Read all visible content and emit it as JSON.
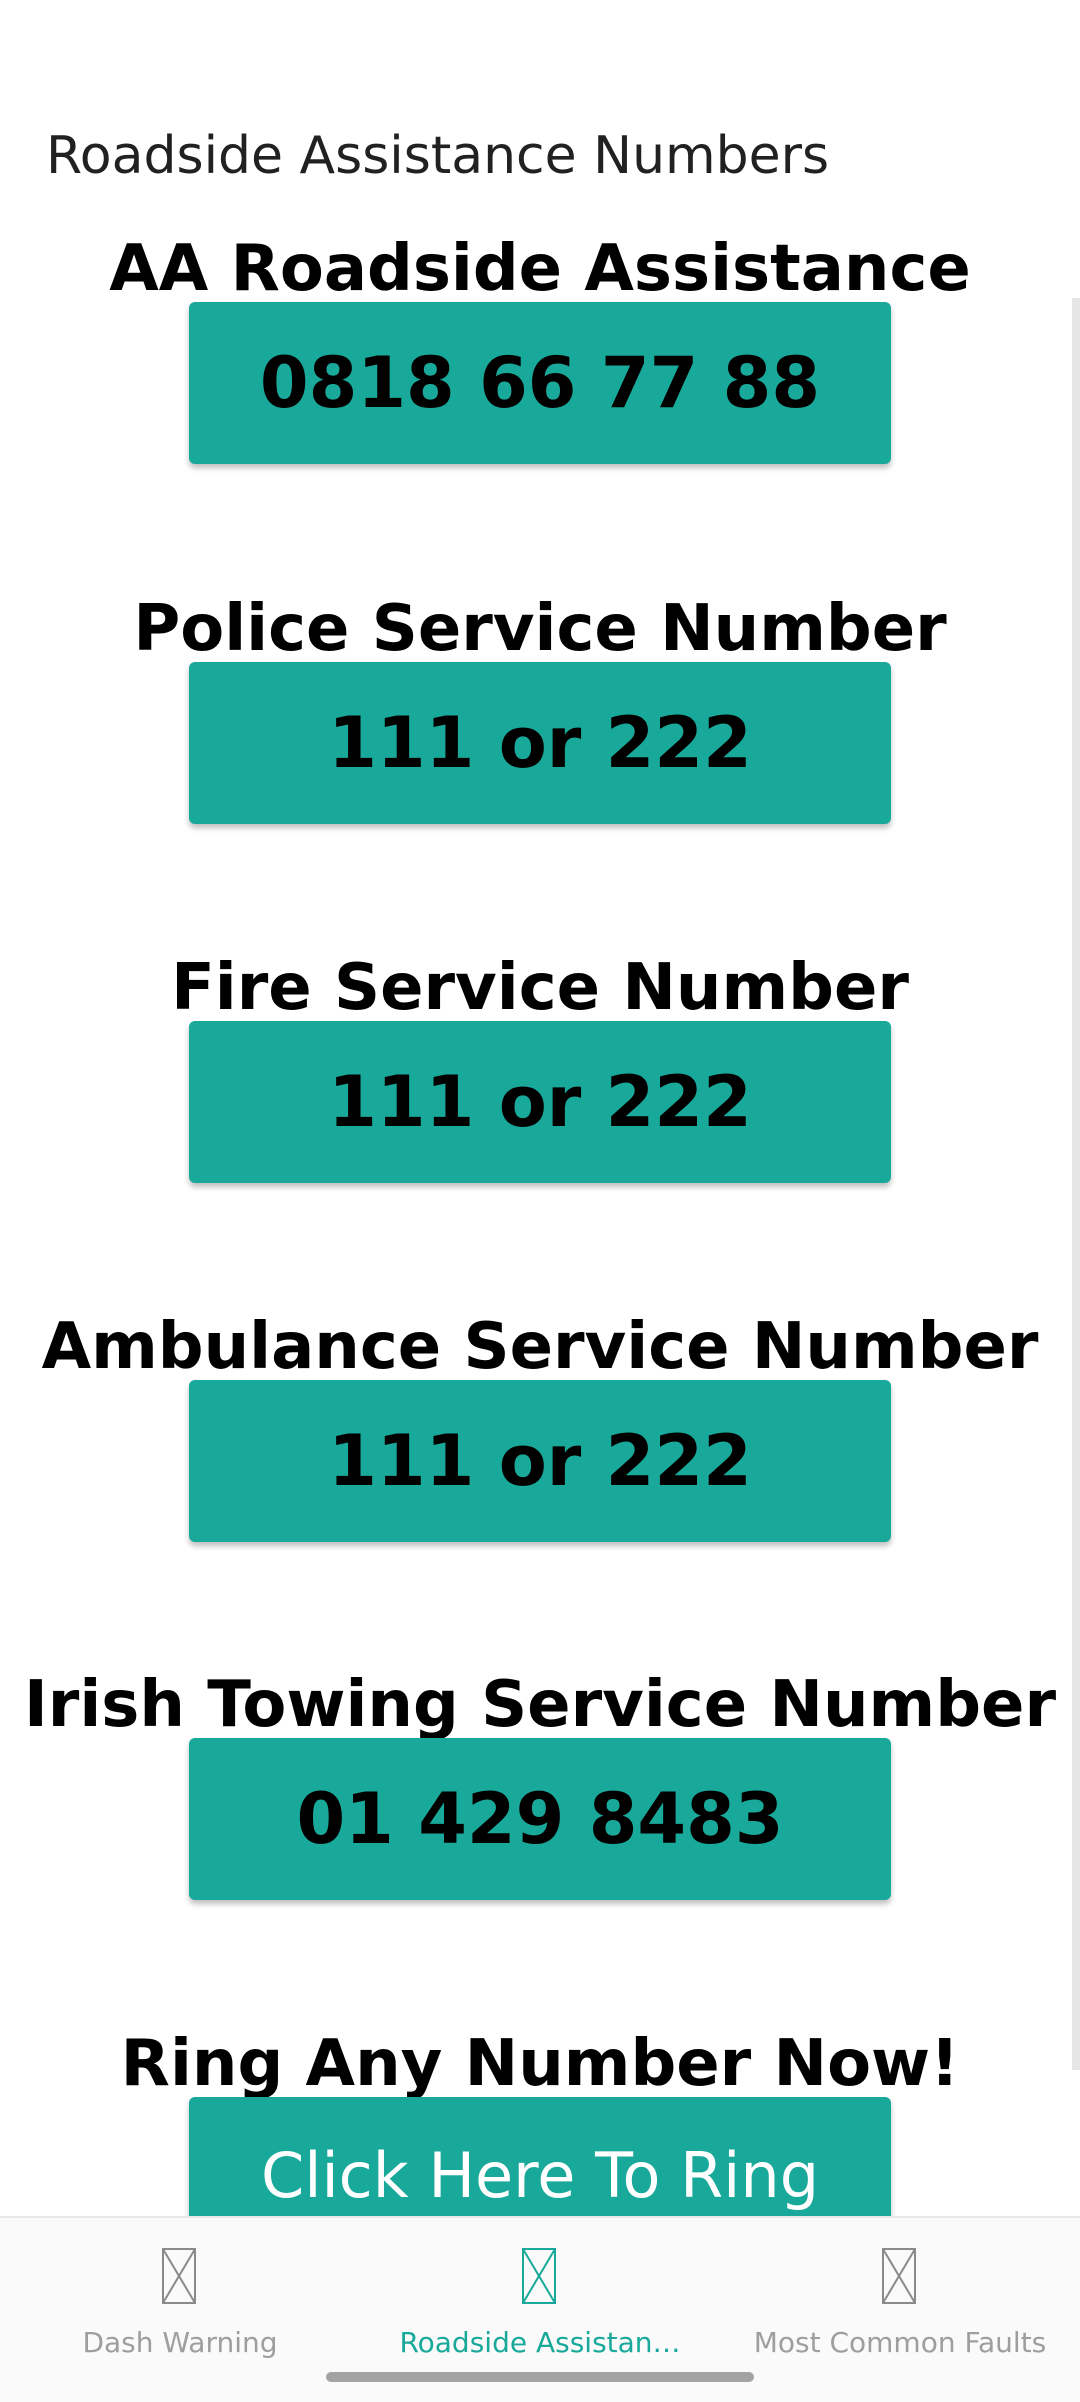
{
  "app_bar": {
    "title": "Roadside Assistance Numbers"
  },
  "sections": [
    {
      "title": "AA Roadside Assistance",
      "number": "0818 66 77 88"
    },
    {
      "title": "Police Service Number",
      "number": "111 or 222"
    },
    {
      "title": "Fire Service Number",
      "number": "111 or 222"
    },
    {
      "title": "Ambulance Service Number",
      "number": "111 or 222"
    },
    {
      "title": "Irish Towing Service Number",
      "number": "01 429 8483"
    },
    {
      "title": "Ring Any Number Now!",
      "number": "Click Here To Ring"
    }
  ],
  "bottom_nav": {
    "items": [
      {
        "label": "Dash Warning",
        "icon": "image-placeholder-icon",
        "active": false
      },
      {
        "label": "Roadside Assistan…",
        "icon": "image-placeholder-icon",
        "active": true
      },
      {
        "label": "Most Common Faults",
        "icon": "image-placeholder-icon",
        "active": false
      }
    ]
  },
  "colors": {
    "accent": "#19a99a",
    "inactive": "#9e9e9e",
    "text": "#000000"
  }
}
